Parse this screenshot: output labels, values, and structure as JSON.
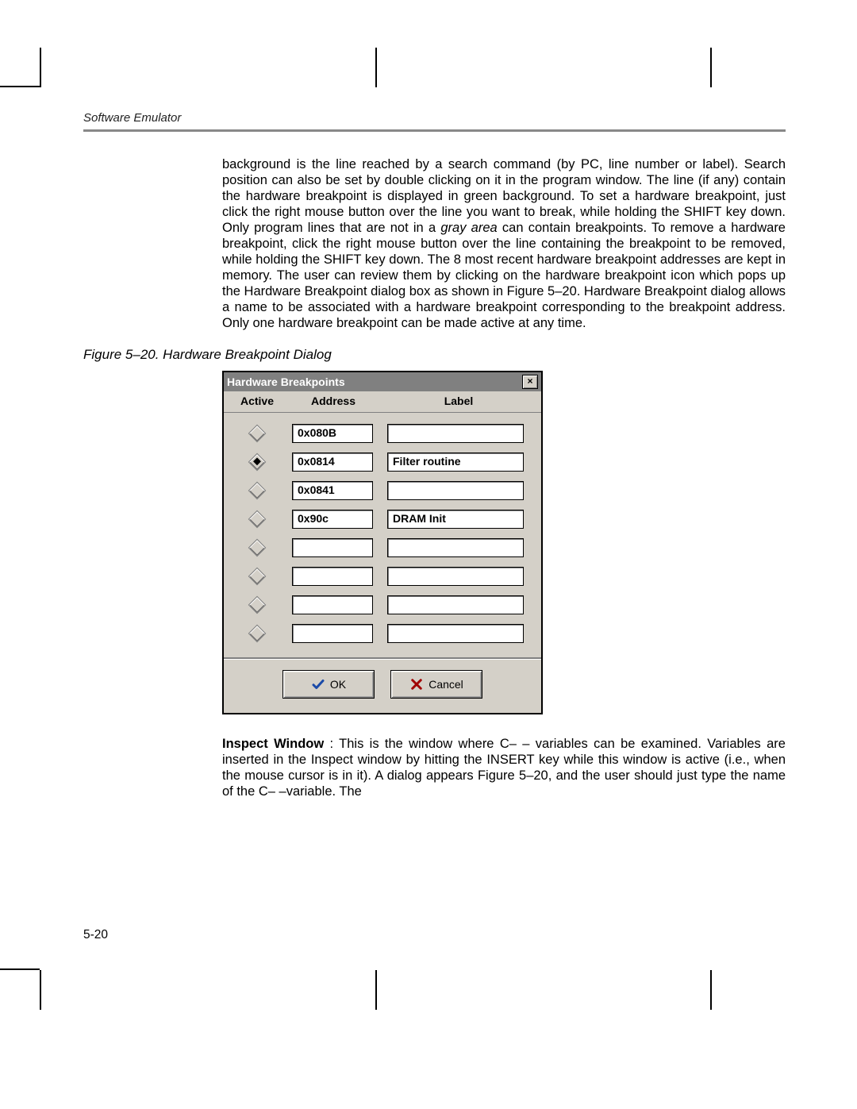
{
  "running_head": "Software Emulator",
  "para1_a": "background is the line reached by a search command (by PC, line number or label). Search position can also be set by double clicking on it in the program window. The line (if any) contain the hardware breakpoint is displayed in green background. To set a hardware breakpoint, just click the right mouse button over the line you want to break, while holding the SHIFT key down. Only program lines that are not in a ",
  "para1_gray": "gray area",
  "para1_b": " can contain breakpoints. To remove a hardware breakpoint, click the right mouse button over the line containing the breakpoint to be removed, while holding the SHIFT key down. The 8 most recent hardware breakpoint addresses are kept in memory. The user can review them by clicking on the hardware breakpoint icon which pops up the Hardware Breakpoint dialog box as shown in Figure 5–20. Hardware Breakpoint dialog allows a name to be associated with a hardware breakpoint corresponding to the breakpoint address. Only one hardware breakpoint can be made active at any time.",
  "figure_caption": "Figure 5–20. Hardware Breakpoint Dialog",
  "dialog": {
    "title": "Hardware Breakpoints",
    "close": "×",
    "headers": {
      "active": "Active",
      "address": "Address",
      "label": "Label"
    },
    "rows": [
      {
        "selected": false,
        "address": "0x080B",
        "label": ""
      },
      {
        "selected": true,
        "address": "0x0814",
        "label": "Filter routine"
      },
      {
        "selected": false,
        "address": "0x0841",
        "label": ""
      },
      {
        "selected": false,
        "address": "0x90c",
        "label": "DRAM Init"
      },
      {
        "selected": false,
        "address": "",
        "label": ""
      },
      {
        "selected": false,
        "address": "",
        "label": ""
      },
      {
        "selected": false,
        "address": "",
        "label": ""
      },
      {
        "selected": false,
        "address": "",
        "label": ""
      }
    ],
    "ok": "OK",
    "cancel": "Cancel"
  },
  "para2_lead": "Inspect Window",
  "para2_rest": " : This is the window where C– – variables can be examined. Variables are inserted in the Inspect window by hitting the INSERT key while this window is active (i.e., when the mouse cursor is in it). A dialog appears Figure 5–20, and the user should just type the name of the C– –variable. The",
  "page_number": "5-20"
}
